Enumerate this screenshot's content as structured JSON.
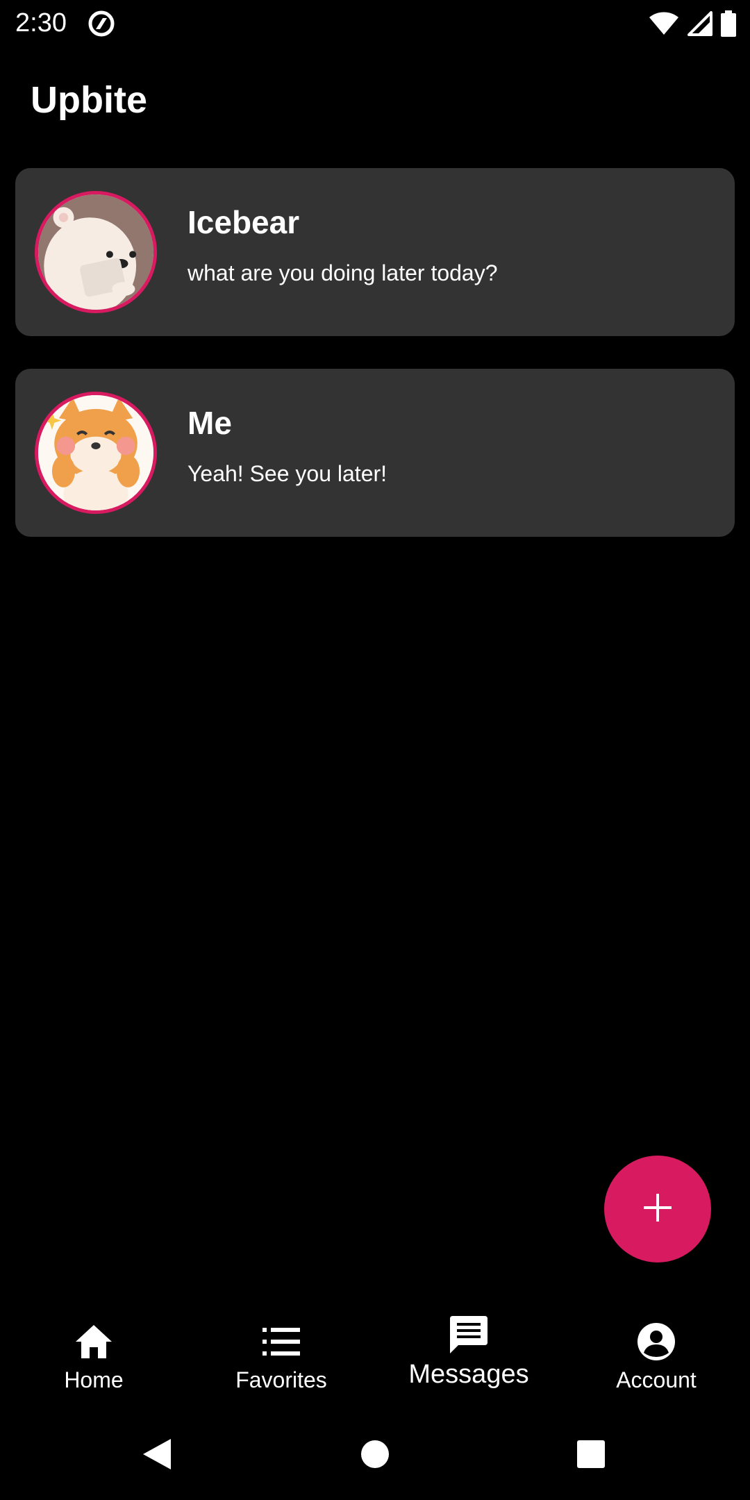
{
  "status_bar": {
    "time": "2:30",
    "icons": [
      "app-notification-icon",
      "wifi-icon",
      "cellular-signal-icon",
      "battery-icon"
    ]
  },
  "app": {
    "title": "Upbite"
  },
  "conversations": [
    {
      "name": "Icebear",
      "preview": "what are you doing later today?",
      "avatar": "polar-bear-avatar"
    },
    {
      "name": "Me",
      "preview": "Yeah! See you later!",
      "avatar": "shiba-dog-avatar"
    }
  ],
  "fab": {
    "icon": "plus-icon"
  },
  "bottom_nav": {
    "items": [
      {
        "label": "Home",
        "icon": "home-icon",
        "active": false
      },
      {
        "label": "Favorites",
        "icon": "list-icon",
        "active": false
      },
      {
        "label": "Messages",
        "icon": "message-icon",
        "active": true
      },
      {
        "label": "Account",
        "icon": "account-circle-icon",
        "active": false
      }
    ]
  },
  "system_nav": {
    "icons": [
      "back-icon",
      "home-circle-icon",
      "recents-icon"
    ]
  },
  "colors": {
    "background": "#000000",
    "card": "#333333",
    "accent": "#d81b60",
    "text": "#ffffff"
  }
}
